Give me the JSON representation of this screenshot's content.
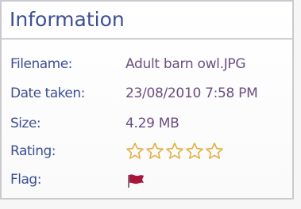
{
  "panel": {
    "title": "Information"
  },
  "fields": {
    "filename": {
      "label": "Filename:",
      "value": "Adult barn owl.JPG"
    },
    "date_taken": {
      "label": "Date taken:",
      "value": "23/08/2010  7:58 PM"
    },
    "size": {
      "label": "Size:",
      "value": "4.29 MB"
    },
    "rating": {
      "label": "Rating:",
      "stars_total": 5,
      "stars_filled": 0,
      "star_color": "#e2b040"
    },
    "flag": {
      "label": "Flag:",
      "icon": "flag-icon",
      "color": "#a8143a"
    }
  },
  "colors": {
    "label": "#3d4f94",
    "value": "#6b4f80"
  }
}
